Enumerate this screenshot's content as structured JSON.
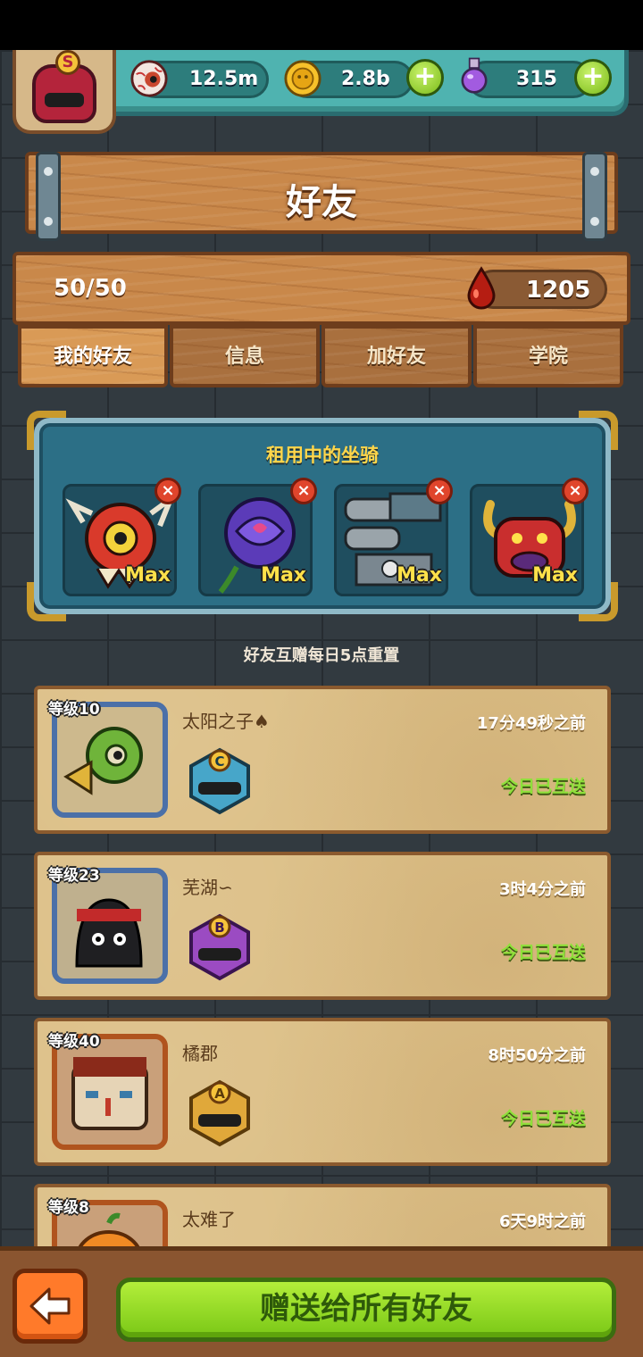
{
  "header": {
    "rank_letter": "S",
    "resources": [
      {
        "icon": "eyeball-icon",
        "value": "12.5m"
      },
      {
        "icon": "gold-coin-icon",
        "value": "2.8b"
      },
      {
        "icon": "potion-icon",
        "value": "315"
      }
    ]
  },
  "page": {
    "title": "好友"
  },
  "stats": {
    "friend_count": "50/50",
    "blood_value": "1205"
  },
  "tabs": [
    {
      "label": "我的好友",
      "active": true
    },
    {
      "label": "信息",
      "active": false
    },
    {
      "label": "加好友",
      "active": false
    },
    {
      "label": "学院",
      "active": false
    }
  ],
  "rental": {
    "title": "租用中的坐骑",
    "mounts": [
      {
        "label": "Max",
        "icon": "lion-dance-mount-icon"
      },
      {
        "label": "Max",
        "icon": "purple-rose-mount-icon"
      },
      {
        "label": "Max",
        "icon": "mech-cannon-mount-icon"
      },
      {
        "label": "Max",
        "icon": "red-demon-mount-icon"
      }
    ]
  },
  "reset_note": "好友互赠每日5点重置",
  "friends": [
    {
      "level": "等级10",
      "name": "太阳之子♠",
      "time": "17分49秒之前",
      "status": "今日已互送",
      "rank": "C",
      "rank_color": "#47a6c9"
    },
    {
      "level": "等级23",
      "name": "芜湖∽",
      "time": "3时4分之前",
      "status": "今日已互送",
      "rank": "B",
      "rank_color": "#9b4bc2"
    },
    {
      "level": "等级40",
      "name": "橘郡",
      "time": "8时50分之前",
      "status": "今日已互送",
      "rank": "A",
      "rank_color": "#e0a83a"
    },
    {
      "level": "等级8",
      "name": "太难了",
      "time": "6天9时之前",
      "status": "",
      "rank": "",
      "rank_color": "#e0a83a"
    }
  ],
  "footer": {
    "send_all_label": "赠送给所有好友"
  }
}
